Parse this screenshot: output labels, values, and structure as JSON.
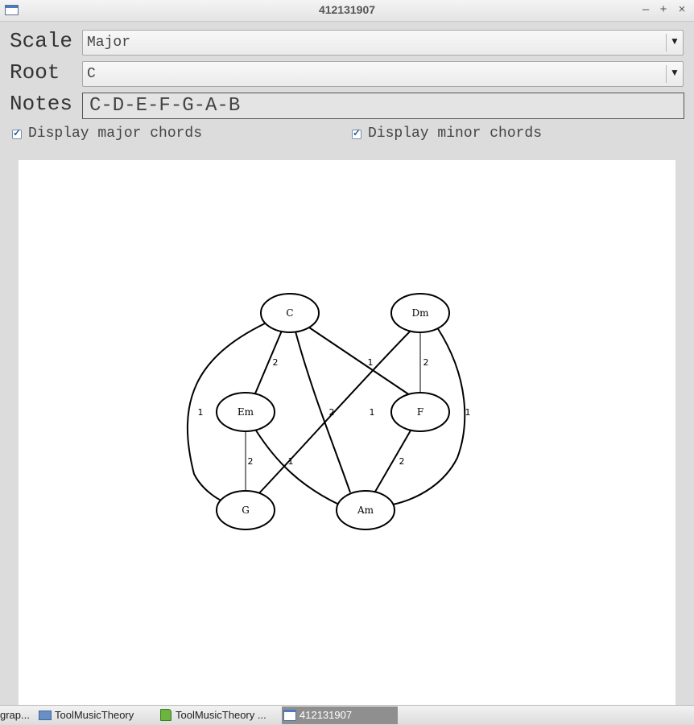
{
  "window": {
    "title": "412131907"
  },
  "controls": {
    "scale_label": "Scale",
    "scale_value": "Major",
    "root_label": "Root",
    "root_value": "C",
    "notes_label": "Notes",
    "notes_value": "C-D-E-F-G-A-B",
    "major_chords_label": "Display major chords",
    "major_chords_checked": true,
    "minor_chords_label": "Display minor chords",
    "minor_chords_checked": true
  },
  "graph": {
    "nodes": [
      {
        "id": "C",
        "label": "C"
      },
      {
        "id": "Dm",
        "label": "Dm"
      },
      {
        "id": "Em",
        "label": "Em"
      },
      {
        "id": "F",
        "label": "F"
      },
      {
        "id": "G",
        "label": "G"
      },
      {
        "id": "Am",
        "label": "Am"
      }
    ],
    "edges": [
      {
        "from": "C",
        "to": "Em",
        "weight": "2"
      },
      {
        "from": "C",
        "to": "F",
        "weight": "1"
      },
      {
        "from": "C",
        "to": "G",
        "weight": "1"
      },
      {
        "from": "C",
        "to": "Am",
        "weight": "2"
      },
      {
        "from": "Dm",
        "to": "F",
        "weight": "2"
      },
      {
        "from": "Dm",
        "to": "G",
        "weight": "1"
      },
      {
        "from": "Dm",
        "to": "Am",
        "weight": "1"
      },
      {
        "from": "Em",
        "to": "G",
        "weight": "2"
      },
      {
        "from": "Em",
        "to": "Am",
        "weight": "1"
      },
      {
        "from": "F",
        "to": "Am",
        "weight": "2"
      }
    ]
  },
  "taskbar": {
    "items": [
      {
        "label": "grap..."
      },
      {
        "label": "ToolMusicTheory"
      },
      {
        "label": "ToolMusicTheory ..."
      },
      {
        "label": "412131907"
      }
    ]
  }
}
